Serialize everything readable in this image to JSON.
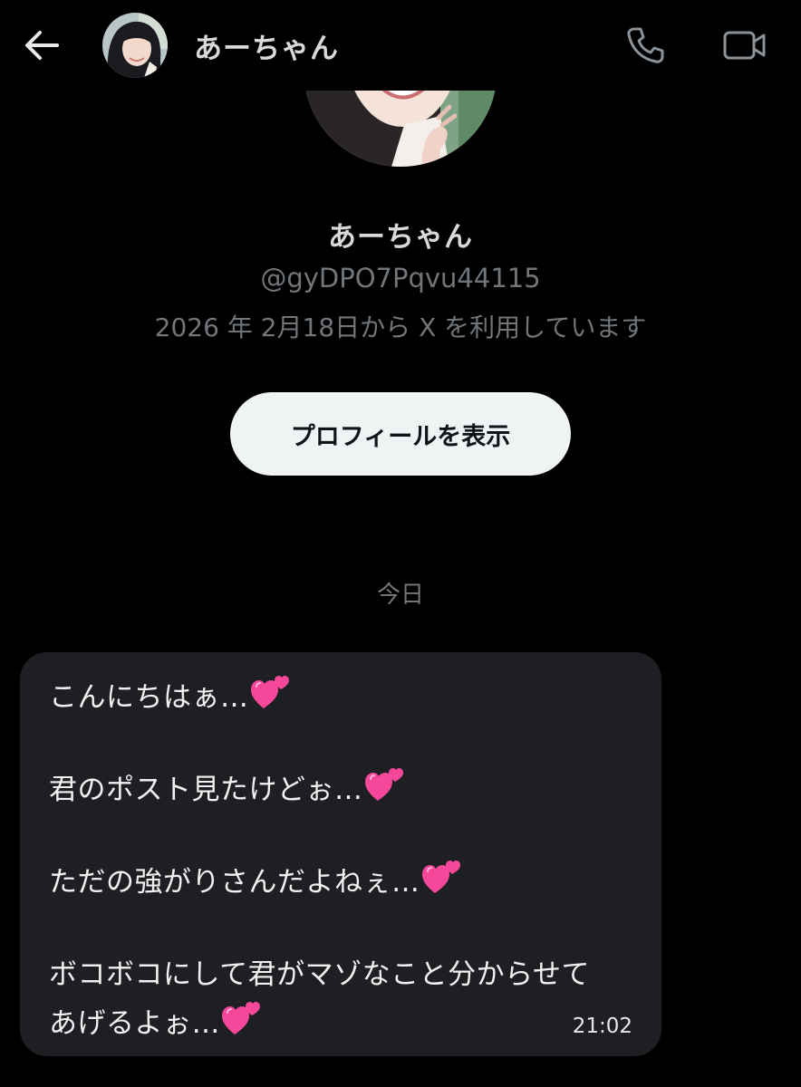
{
  "header": {
    "back_icon": "arrow-left-icon",
    "name": "あーちゃん",
    "call_icon": "phone-icon",
    "video_icon": "video-camera-icon"
  },
  "profile": {
    "name": "あーちゃん",
    "handle": "@gyDPO7Pqvu44115",
    "joined": "2026 年 2月18日から X を利用しています",
    "view_profile_label": "プロフィールを表示"
  },
  "conversation": {
    "date_label": "今日",
    "message": {
      "lines": [
        "こんにちはぁ…",
        "君のポスト見たけどぉ…",
        "ただの強がりさんだよねぇ…",
        "ボコボコにして君がマゾなこと分からせて",
        "あげるよぉ…"
      ],
      "emoji_icon": "two-hearts-icon",
      "time": "21:02"
    }
  },
  "colors": {
    "background": "#000000",
    "bubble": "#1d1f23",
    "secondary_text": "#71767b",
    "button_bg": "#eff3f4",
    "heart_pink": "#f5489b"
  }
}
